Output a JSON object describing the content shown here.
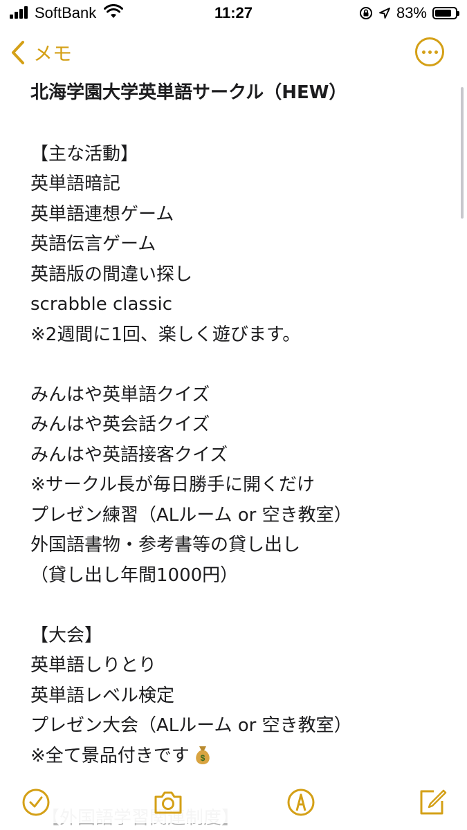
{
  "status_bar": {
    "carrier": "SoftBank",
    "time": "11:27",
    "battery_percent": "83%",
    "battery_level": 0.83
  },
  "nav": {
    "back_label": "メモ"
  },
  "note": {
    "title": "北海学園大学英単語サークル（HEW）",
    "lines": [
      "",
      "【主な活動】",
      "英単語暗記",
      "英単語連想ゲーム",
      "英語伝言ゲーム",
      "英語版の間違い探し",
      "scrabble classic",
      "※2週間に1回、楽しく遊びます。",
      "",
      "みんはや英単語クイズ",
      "みんはや英会話クイズ",
      "みんはや英語接客クイズ",
      "※サークル長が毎日勝手に開くだけ",
      "プレゼン練習（ALルーム or 空き教室）",
      "外国語書物・参考書等の貸し出し",
      "（貸し出し年間1000円）",
      "",
      "【大会】",
      "英単語しりとり",
      "英単語レベル検定",
      "プレゼン大会（ALルーム or 空き教室）",
      "※全て景品付きです"
    ],
    "partial_line": "【外国語学習関連制度】"
  },
  "colors": {
    "accent": "#d4a017",
    "text": "#1c1c1e"
  },
  "toolbar": {
    "icons": [
      "checklist-icon",
      "camera-icon",
      "markup-icon",
      "compose-icon"
    ]
  }
}
